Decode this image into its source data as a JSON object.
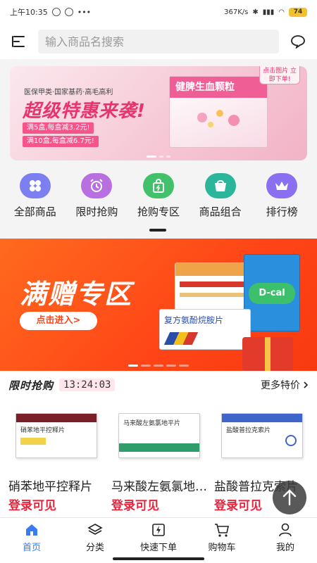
{
  "status_bar": {
    "time": "上午10:35",
    "network_speed": "367K/s",
    "battery": "74"
  },
  "header": {
    "search_placeholder": "输入商品名搜索",
    "menu_icon": "menu-icon",
    "chat_icon": "chat-bubble-icon"
  },
  "banner1": {
    "subtitle": "医保甲类·国家基药·高毛高利",
    "title": "超级特惠来袭!",
    "offer1": "满5盒,每盒减3.2元!",
    "offer2": "满10盒,每盒减6.7元!",
    "product_name": "健脾生血颗粒",
    "corner_tag": "点击图片 立即下单!"
  },
  "quick_nav": [
    {
      "label": "全部商品",
      "icon": "clover-icon",
      "color": "#7b7ff0"
    },
    {
      "label": "限时抢购",
      "icon": "alarm-clock-icon",
      "color": "#b86fe0"
    },
    {
      "label": "抢购专区",
      "icon": "shopping-bag-icon",
      "color": "#43c06a"
    },
    {
      "label": "商品组合",
      "icon": "basket-icon",
      "color": "#2bb59a"
    },
    {
      "label": "排行榜",
      "icon": "crown-icon",
      "color": "#8a6ff0"
    }
  ],
  "banner2": {
    "title": "满赠专区",
    "button": "点击进入>",
    "product_label": "复方氨酚烷胺片",
    "brand_label": "D-cal"
  },
  "flash_sale": {
    "logo": "限时抢购",
    "timer": "13:24:03",
    "more": "更多特价"
  },
  "products": [
    {
      "name": "硝苯地平控释片",
      "price": "登录可见",
      "box_label": "硝苯地平控释片",
      "band_color": "#7a1f2a"
    },
    {
      "name": "马来酸左氨氯地平片",
      "price": "登录可见",
      "box_label": "马来酸左氨氯地平片",
      "band_color": "#2f9d6a"
    },
    {
      "name": "盐酸普拉克索片",
      "price": "登录可见",
      "box_label": "盐酸普拉克索片",
      "band_color": "#3d66c8"
    }
  ],
  "tabbar": [
    {
      "label": "首页",
      "icon": "home-icon",
      "active": true
    },
    {
      "label": "分类",
      "icon": "layers-icon",
      "active": false
    },
    {
      "label": "快速下单",
      "icon": "quick-order-icon",
      "active": false
    },
    {
      "label": "购物车",
      "icon": "cart-icon",
      "active": false
    },
    {
      "label": "我的",
      "icon": "user-icon",
      "active": false
    }
  ],
  "colors": {
    "accent": "#3a7bf0",
    "price_red": "#e6253d",
    "banner2_orange": "#ff4517"
  }
}
